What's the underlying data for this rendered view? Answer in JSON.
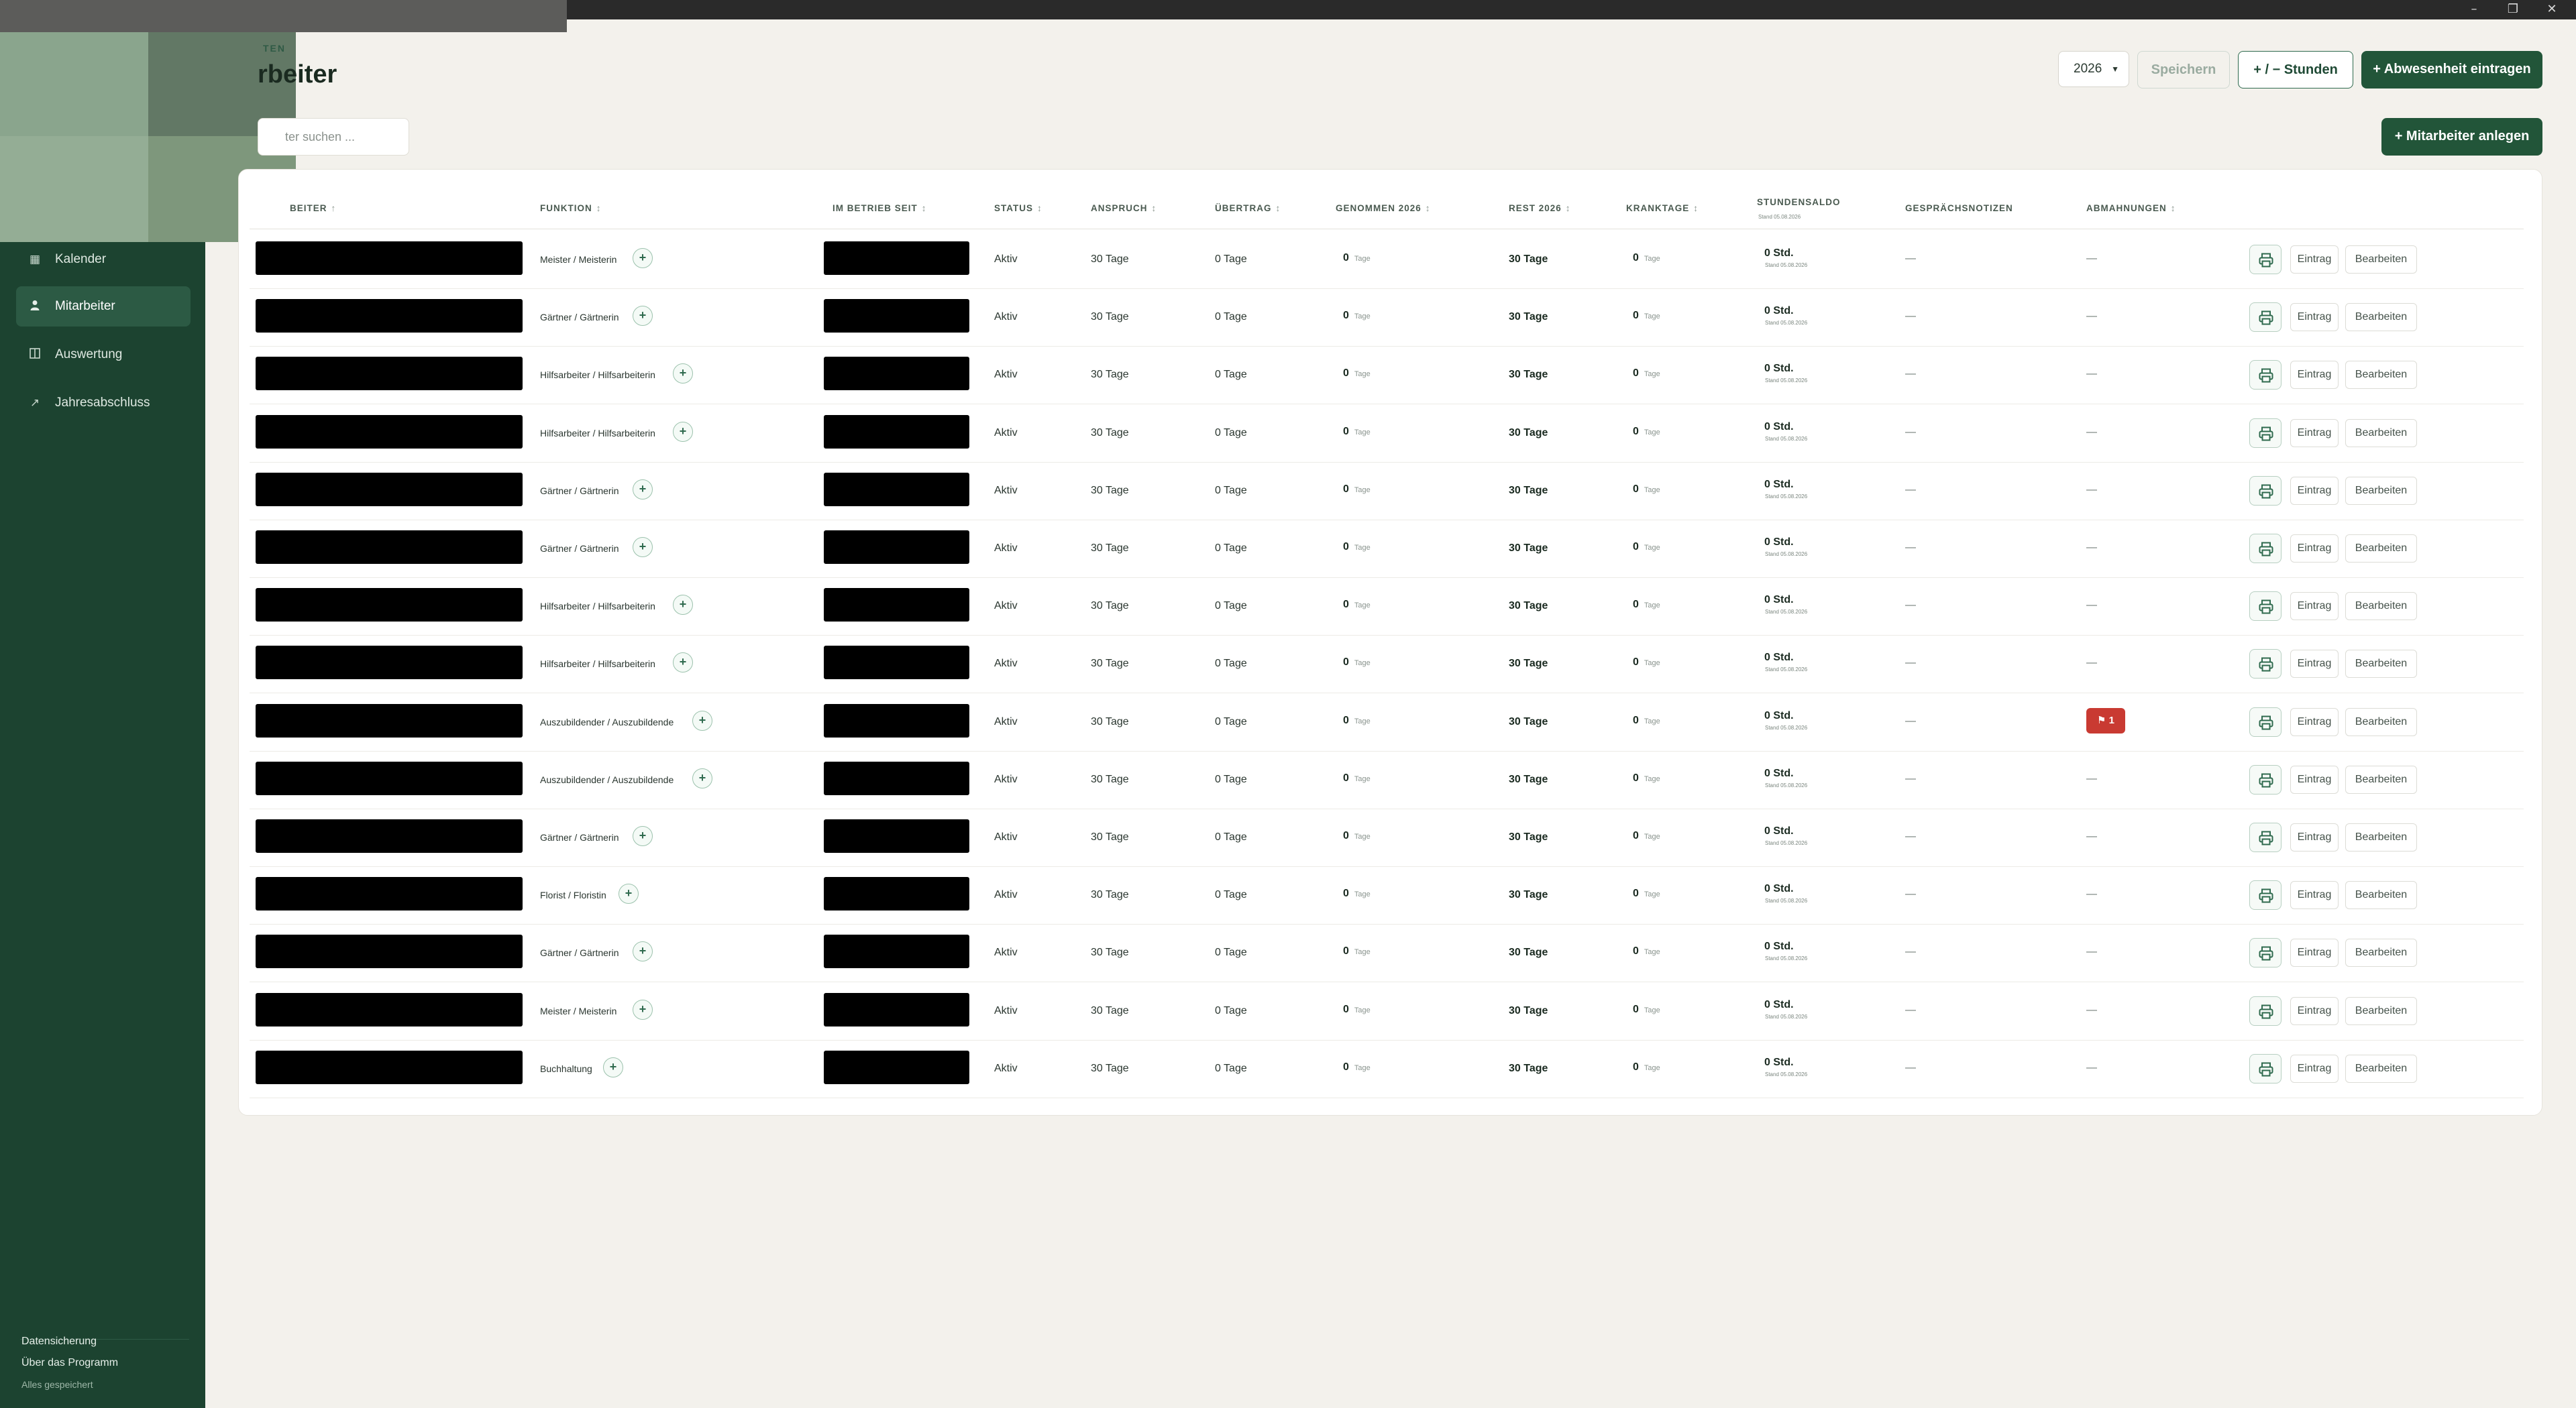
{
  "sidebar": {
    "nav": [
      {
        "label": "Kalender",
        "icon": "calendar-icon",
        "active": false
      },
      {
        "label": "Mitarbeiter",
        "icon": "person-icon",
        "active": true
      },
      {
        "label": "Auswertung",
        "icon": "columns-icon",
        "active": false
      },
      {
        "label": "Jahresabschluss",
        "icon": "trend-arrow-icon",
        "active": false
      }
    ],
    "footer": {
      "backup": "Datensicherung",
      "about": "Über das Programm",
      "status": "Alles gespeichert"
    }
  },
  "page": {
    "eyebrow": "TEN",
    "title": "rbeiter",
    "search_placeholder": "ter suchen ..."
  },
  "toolbar": {
    "year": "2026",
    "save": "Speichern",
    "hours": "+ / − Stunden",
    "absence": "+ Abwesenheit eintragen",
    "add_employee": "+ Mitarbeiter anlegen"
  },
  "table": {
    "headers": {
      "name": "BEITER",
      "function": "FUNKTION",
      "since": "IM BETRIEB SEIT",
      "status": "STATUS",
      "entitlement": "ANSPRUCH",
      "carryover": "ÜBERTRAG",
      "taken": "GENOMMEN 2026",
      "rest": "REST 2026",
      "sick": "KRANKTAGE",
      "hours_balance": "STUNDENSALDO",
      "hours_balance_sub": "Stand 05.08.2026",
      "notes": "GESPRÄCHSNOTIZEN",
      "warnings": "ABMAHNUNGEN"
    },
    "sort_name": "↑",
    "sort_other": "↕",
    "rows": [
      {
        "function": "Meister / Meisterin",
        "status": "Aktiv",
        "entitlement": "30 Tage",
        "carryover": "0 Tage",
        "taken": "0",
        "rest": "30 Tage",
        "sick": "0",
        "balance": "0 Std.",
        "balance_sub": "Stand 05.08.2026",
        "notes": "—",
        "warnings": "—"
      },
      {
        "function": "Gärtner / Gärtnerin",
        "status": "Aktiv",
        "entitlement": "30 Tage",
        "carryover": "0 Tage",
        "taken": "0",
        "rest": "30 Tage",
        "sick": "0",
        "balance": "0 Std.",
        "balance_sub": "Stand 05.08.2026",
        "notes": "—",
        "warnings": "—"
      },
      {
        "function": "Hilfsarbeiter / Hilfsarbeiterin",
        "status": "Aktiv",
        "entitlement": "30 Tage",
        "carryover": "0 Tage",
        "taken": "0",
        "rest": "30 Tage",
        "sick": "0",
        "balance": "0 Std.",
        "balance_sub": "Stand 05.08.2026",
        "notes": "—",
        "warnings": "—"
      },
      {
        "function": "Hilfsarbeiter / Hilfsarbeiterin",
        "status": "Aktiv",
        "entitlement": "30 Tage",
        "carryover": "0 Tage",
        "taken": "0",
        "rest": "30 Tage",
        "sick": "0",
        "balance": "0 Std.",
        "balance_sub": "Stand 05.08.2026",
        "notes": "—",
        "warnings": "—"
      },
      {
        "function": "Gärtner / Gärtnerin",
        "status": "Aktiv",
        "entitlement": "30 Tage",
        "carryover": "0 Tage",
        "taken": "0",
        "rest": "30 Tage",
        "sick": "0",
        "balance": "0 Std.",
        "balance_sub": "Stand 05.08.2026",
        "notes": "—",
        "warnings": "—"
      },
      {
        "function": "Gärtner / Gärtnerin",
        "status": "Aktiv",
        "entitlement": "30 Tage",
        "carryover": "0 Tage",
        "taken": "0",
        "rest": "30 Tage",
        "sick": "0",
        "balance": "0 Std.",
        "balance_sub": "Stand 05.08.2026",
        "notes": "—",
        "warnings": "—"
      },
      {
        "function": "Hilfsarbeiter / Hilfsarbeiterin",
        "status": "Aktiv",
        "entitlement": "30 Tage",
        "carryover": "0 Tage",
        "taken": "0",
        "rest": "30 Tage",
        "sick": "0",
        "balance": "0 Std.",
        "balance_sub": "Stand 05.08.2026",
        "notes": "—",
        "warnings": "—"
      },
      {
        "function": "Hilfsarbeiter / Hilfsarbeiterin",
        "status": "Aktiv",
        "entitlement": "30 Tage",
        "carryover": "0 Tage",
        "taken": "0",
        "rest": "30 Tage",
        "sick": "0",
        "balance": "0 Std.",
        "balance_sub": "Stand 05.08.2026",
        "notes": "—",
        "warnings": "—"
      },
      {
        "function": "Auszubildender / Auszubildende",
        "status": "Aktiv",
        "entitlement": "30 Tage",
        "carryover": "0 Tage",
        "taken": "0",
        "rest": "30 Tage",
        "sick": "0",
        "balance": "0 Std.",
        "balance_sub": "Stand 05.08.2026",
        "notes": "—",
        "warnings": "1",
        "warning_badge": true
      },
      {
        "function": "Auszubildender / Auszubildende",
        "status": "Aktiv",
        "entitlement": "30 Tage",
        "carryover": "0 Tage",
        "taken": "0",
        "rest": "30 Tage",
        "sick": "0",
        "balance": "0 Std.",
        "balance_sub": "Stand 05.08.2026",
        "notes": "—",
        "warnings": "—"
      },
      {
        "function": "Gärtner / Gärtnerin",
        "status": "Aktiv",
        "entitlement": "30 Tage",
        "carryover": "0 Tage",
        "taken": "0",
        "rest": "30 Tage",
        "sick": "0",
        "balance": "0 Std.",
        "balance_sub": "Stand 05.08.2026",
        "notes": "—",
        "warnings": "—"
      },
      {
        "function": "Florist / Floristin",
        "status": "Aktiv",
        "entitlement": "30 Tage",
        "carryover": "0 Tage",
        "taken": "0",
        "rest": "30 Tage",
        "sick": "0",
        "balance": "0 Std.",
        "balance_sub": "Stand 05.08.2026",
        "notes": "—",
        "warnings": "—"
      },
      {
        "function": "Gärtner / Gärtnerin",
        "status": "Aktiv",
        "entitlement": "30 Tage",
        "carryover": "0 Tage",
        "taken": "0",
        "rest": "30 Tage",
        "sick": "0",
        "balance": "0 Std.",
        "balance_sub": "Stand 05.08.2026",
        "notes": "—",
        "warnings": "—"
      },
      {
        "function": "Meister / Meisterin",
        "status": "Aktiv",
        "entitlement": "30 Tage",
        "carryover": "0 Tage",
        "taken": "0",
        "rest": "30 Tage",
        "sick": "0",
        "balance": "0 Std.",
        "balance_sub": "Stand 05.08.2026",
        "notes": "—",
        "warnings": "—"
      },
      {
        "function": "Buchhaltung",
        "status": "Aktiv",
        "entitlement": "30 Tage",
        "carryover": "0 Tage",
        "taken": "0",
        "rest": "30 Tage",
        "sick": "0",
        "balance": "0 Std.",
        "balance_sub": "Stand 05.08.2026",
        "notes": "—",
        "warnings": "—"
      }
    ],
    "units": {
      "days_small": "Tage"
    },
    "actions": {
      "print": "printer-icon",
      "entry": "Eintrag",
      "edit": "Bearbeiten",
      "add_function": "+"
    }
  },
  "colors": {
    "sidebar": "#1c4330",
    "accent": "#225539",
    "warning": "#c93a32",
    "background": "#f3f1ec"
  }
}
